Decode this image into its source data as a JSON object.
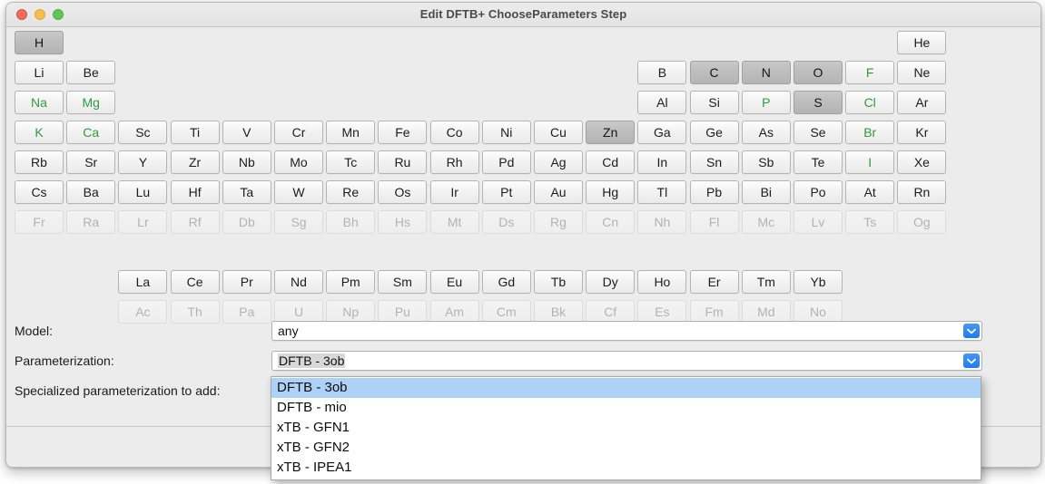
{
  "window": {
    "title": "Edit DFTB+ ChooseParameters Step",
    "traffic_lights": [
      {
        "name": "close",
        "color": "#ec6a5f"
      },
      {
        "name": "minimize",
        "color": "#f5bd4f"
      },
      {
        "name": "maximize",
        "color": "#61c555"
      }
    ]
  },
  "colors": {
    "available_element_text": "#2e9b3c",
    "selected_element_bg": "#bdbdbd",
    "disabled_element_text": "#b3b3b3",
    "dropdown_highlight": "#aed2f7",
    "combo_arrow_blue": "#1f7af0"
  },
  "periodic_table": {
    "elements": [
      {
        "sym": "H",
        "col": 1,
        "row": 1,
        "state": "selected"
      },
      {
        "sym": "He",
        "col": 18,
        "row": 1,
        "state": "normal"
      },
      {
        "sym": "Li",
        "col": 1,
        "row": 2,
        "state": "normal"
      },
      {
        "sym": "Be",
        "col": 2,
        "row": 2,
        "state": "normal"
      },
      {
        "sym": "B",
        "col": 13,
        "row": 2,
        "state": "normal"
      },
      {
        "sym": "C",
        "col": 14,
        "row": 2,
        "state": "selected"
      },
      {
        "sym": "N",
        "col": 15,
        "row": 2,
        "state": "selected"
      },
      {
        "sym": "O",
        "col": 16,
        "row": 2,
        "state": "selected"
      },
      {
        "sym": "F",
        "col": 17,
        "row": 2,
        "state": "available"
      },
      {
        "sym": "Ne",
        "col": 18,
        "row": 2,
        "state": "normal"
      },
      {
        "sym": "Na",
        "col": 1,
        "row": 3,
        "state": "available"
      },
      {
        "sym": "Mg",
        "col": 2,
        "row": 3,
        "state": "available"
      },
      {
        "sym": "Al",
        "col": 13,
        "row": 3,
        "state": "normal"
      },
      {
        "sym": "Si",
        "col": 14,
        "row": 3,
        "state": "normal"
      },
      {
        "sym": "P",
        "col": 15,
        "row": 3,
        "state": "available"
      },
      {
        "sym": "S",
        "col": 16,
        "row": 3,
        "state": "selected"
      },
      {
        "sym": "Cl",
        "col": 17,
        "row": 3,
        "state": "available"
      },
      {
        "sym": "Ar",
        "col": 18,
        "row": 3,
        "state": "normal"
      },
      {
        "sym": "K",
        "col": 1,
        "row": 4,
        "state": "available"
      },
      {
        "sym": "Ca",
        "col": 2,
        "row": 4,
        "state": "available"
      },
      {
        "sym": "Sc",
        "col": 3,
        "row": 4,
        "state": "normal"
      },
      {
        "sym": "Ti",
        "col": 4,
        "row": 4,
        "state": "normal"
      },
      {
        "sym": "V",
        "col": 5,
        "row": 4,
        "state": "normal"
      },
      {
        "sym": "Cr",
        "col": 6,
        "row": 4,
        "state": "normal"
      },
      {
        "sym": "Mn",
        "col": 7,
        "row": 4,
        "state": "normal"
      },
      {
        "sym": "Fe",
        "col": 8,
        "row": 4,
        "state": "normal"
      },
      {
        "sym": "Co",
        "col": 9,
        "row": 4,
        "state": "normal"
      },
      {
        "sym": "Ni",
        "col": 10,
        "row": 4,
        "state": "normal"
      },
      {
        "sym": "Cu",
        "col": 11,
        "row": 4,
        "state": "normal"
      },
      {
        "sym": "Zn",
        "col": 12,
        "row": 4,
        "state": "selected"
      },
      {
        "sym": "Ga",
        "col": 13,
        "row": 4,
        "state": "normal"
      },
      {
        "sym": "Ge",
        "col": 14,
        "row": 4,
        "state": "normal"
      },
      {
        "sym": "As",
        "col": 15,
        "row": 4,
        "state": "normal"
      },
      {
        "sym": "Se",
        "col": 16,
        "row": 4,
        "state": "normal"
      },
      {
        "sym": "Br",
        "col": 17,
        "row": 4,
        "state": "available"
      },
      {
        "sym": "Kr",
        "col": 18,
        "row": 4,
        "state": "normal"
      },
      {
        "sym": "Rb",
        "col": 1,
        "row": 5,
        "state": "normal"
      },
      {
        "sym": "Sr",
        "col": 2,
        "row": 5,
        "state": "normal"
      },
      {
        "sym": "Y",
        "col": 3,
        "row": 5,
        "state": "normal"
      },
      {
        "sym": "Zr",
        "col": 4,
        "row": 5,
        "state": "normal"
      },
      {
        "sym": "Nb",
        "col": 5,
        "row": 5,
        "state": "normal"
      },
      {
        "sym": "Mo",
        "col": 6,
        "row": 5,
        "state": "normal"
      },
      {
        "sym": "Tc",
        "col": 7,
        "row": 5,
        "state": "normal"
      },
      {
        "sym": "Ru",
        "col": 8,
        "row": 5,
        "state": "normal"
      },
      {
        "sym": "Rh",
        "col": 9,
        "row": 5,
        "state": "normal"
      },
      {
        "sym": "Pd",
        "col": 10,
        "row": 5,
        "state": "normal"
      },
      {
        "sym": "Ag",
        "col": 11,
        "row": 5,
        "state": "normal"
      },
      {
        "sym": "Cd",
        "col": 12,
        "row": 5,
        "state": "normal"
      },
      {
        "sym": "In",
        "col": 13,
        "row": 5,
        "state": "normal"
      },
      {
        "sym": "Sn",
        "col": 14,
        "row": 5,
        "state": "normal"
      },
      {
        "sym": "Sb",
        "col": 15,
        "row": 5,
        "state": "normal"
      },
      {
        "sym": "Te",
        "col": 16,
        "row": 5,
        "state": "normal"
      },
      {
        "sym": "I",
        "col": 17,
        "row": 5,
        "state": "available"
      },
      {
        "sym": "Xe",
        "col": 18,
        "row": 5,
        "state": "normal"
      },
      {
        "sym": "Cs",
        "col": 1,
        "row": 6,
        "state": "normal"
      },
      {
        "sym": "Ba",
        "col": 2,
        "row": 6,
        "state": "normal"
      },
      {
        "sym": "Lu",
        "col": 3,
        "row": 6,
        "state": "normal"
      },
      {
        "sym": "Hf",
        "col": 4,
        "row": 6,
        "state": "normal"
      },
      {
        "sym": "Ta",
        "col": 5,
        "row": 6,
        "state": "normal"
      },
      {
        "sym": "W",
        "col": 6,
        "row": 6,
        "state": "normal"
      },
      {
        "sym": "Re",
        "col": 7,
        "row": 6,
        "state": "normal"
      },
      {
        "sym": "Os",
        "col": 8,
        "row": 6,
        "state": "normal"
      },
      {
        "sym": "Ir",
        "col": 9,
        "row": 6,
        "state": "normal"
      },
      {
        "sym": "Pt",
        "col": 10,
        "row": 6,
        "state": "normal"
      },
      {
        "sym": "Au",
        "col": 11,
        "row": 6,
        "state": "normal"
      },
      {
        "sym": "Hg",
        "col": 12,
        "row": 6,
        "state": "normal"
      },
      {
        "sym": "Tl",
        "col": 13,
        "row": 6,
        "state": "normal"
      },
      {
        "sym": "Pb",
        "col": 14,
        "row": 6,
        "state": "normal"
      },
      {
        "sym": "Bi",
        "col": 15,
        "row": 6,
        "state": "normal"
      },
      {
        "sym": "Po",
        "col": 16,
        "row": 6,
        "state": "normal"
      },
      {
        "sym": "At",
        "col": 17,
        "row": 6,
        "state": "normal"
      },
      {
        "sym": "Rn",
        "col": 18,
        "row": 6,
        "state": "normal"
      },
      {
        "sym": "Fr",
        "col": 1,
        "row": 7,
        "state": "disabled"
      },
      {
        "sym": "Ra",
        "col": 2,
        "row": 7,
        "state": "disabled"
      },
      {
        "sym": "Lr",
        "col": 3,
        "row": 7,
        "state": "disabled"
      },
      {
        "sym": "Rf",
        "col": 4,
        "row": 7,
        "state": "disabled"
      },
      {
        "sym": "Db",
        "col": 5,
        "row": 7,
        "state": "disabled"
      },
      {
        "sym": "Sg",
        "col": 6,
        "row": 7,
        "state": "disabled"
      },
      {
        "sym": "Bh",
        "col": 7,
        "row": 7,
        "state": "disabled"
      },
      {
        "sym": "Hs",
        "col": 8,
        "row": 7,
        "state": "disabled"
      },
      {
        "sym": "Mt",
        "col": 9,
        "row": 7,
        "state": "disabled"
      },
      {
        "sym": "Ds",
        "col": 10,
        "row": 7,
        "state": "disabled"
      },
      {
        "sym": "Rg",
        "col": 11,
        "row": 7,
        "state": "disabled"
      },
      {
        "sym": "Cn",
        "col": 12,
        "row": 7,
        "state": "disabled"
      },
      {
        "sym": "Nh",
        "col": 13,
        "row": 7,
        "state": "disabled"
      },
      {
        "sym": "Fl",
        "col": 14,
        "row": 7,
        "state": "disabled"
      },
      {
        "sym": "Mc",
        "col": 15,
        "row": 7,
        "state": "disabled"
      },
      {
        "sym": "Lv",
        "col": 16,
        "row": 7,
        "state": "disabled"
      },
      {
        "sym": "Ts",
        "col": 17,
        "row": 7,
        "state": "disabled"
      },
      {
        "sym": "Og",
        "col": 18,
        "row": 7,
        "state": "disabled"
      },
      {
        "sym": "La",
        "col": 3,
        "row": 9,
        "state": "normal"
      },
      {
        "sym": "Ce",
        "col": 4,
        "row": 9,
        "state": "normal"
      },
      {
        "sym": "Pr",
        "col": 5,
        "row": 9,
        "state": "normal"
      },
      {
        "sym": "Nd",
        "col": 6,
        "row": 9,
        "state": "normal"
      },
      {
        "sym": "Pm",
        "col": 7,
        "row": 9,
        "state": "normal"
      },
      {
        "sym": "Sm",
        "col": 8,
        "row": 9,
        "state": "normal"
      },
      {
        "sym": "Eu",
        "col": 9,
        "row": 9,
        "state": "normal"
      },
      {
        "sym": "Gd",
        "col": 10,
        "row": 9,
        "state": "normal"
      },
      {
        "sym": "Tb",
        "col": 11,
        "row": 9,
        "state": "normal"
      },
      {
        "sym": "Dy",
        "col": 12,
        "row": 9,
        "state": "normal"
      },
      {
        "sym": "Ho",
        "col": 13,
        "row": 9,
        "state": "normal"
      },
      {
        "sym": "Er",
        "col": 14,
        "row": 9,
        "state": "normal"
      },
      {
        "sym": "Tm",
        "col": 15,
        "row": 9,
        "state": "normal"
      },
      {
        "sym": "Yb",
        "col": 16,
        "row": 9,
        "state": "normal"
      },
      {
        "sym": "Ac",
        "col": 3,
        "row": 10,
        "state": "disabled"
      },
      {
        "sym": "Th",
        "col": 4,
        "row": 10,
        "state": "disabled"
      },
      {
        "sym": "Pa",
        "col": 5,
        "row": 10,
        "state": "disabled"
      },
      {
        "sym": "U",
        "col": 6,
        "row": 10,
        "state": "disabled"
      },
      {
        "sym": "Np",
        "col": 7,
        "row": 10,
        "state": "disabled"
      },
      {
        "sym": "Pu",
        "col": 8,
        "row": 10,
        "state": "disabled"
      },
      {
        "sym": "Am",
        "col": 9,
        "row": 10,
        "state": "disabled"
      },
      {
        "sym": "Cm",
        "col": 10,
        "row": 10,
        "state": "disabled"
      },
      {
        "sym": "Bk",
        "col": 11,
        "row": 10,
        "state": "disabled"
      },
      {
        "sym": "Cf",
        "col": 12,
        "row": 10,
        "state": "disabled"
      },
      {
        "sym": "Es",
        "col": 13,
        "row": 10,
        "state": "disabled"
      },
      {
        "sym": "Fm",
        "col": 14,
        "row": 10,
        "state": "disabled"
      },
      {
        "sym": "Md",
        "col": 15,
        "row": 10,
        "state": "disabled"
      },
      {
        "sym": "No",
        "col": 16,
        "row": 10,
        "state": "disabled"
      }
    ]
  },
  "form": {
    "model": {
      "label": "Model:",
      "value": "any"
    },
    "parameterization": {
      "label": "Parameterization:",
      "value": "DFTB - 3ob"
    },
    "specialized": {
      "label": "Specialized parameterization to add:",
      "value": ""
    }
  },
  "dropdown": {
    "open": true,
    "selected": "DFTB - 3ob",
    "options": [
      "DFTB - 3ob",
      "DFTB - mio",
      "xTB - GFN1",
      "xTB - GFN2",
      "xTB - IPEA1"
    ]
  }
}
